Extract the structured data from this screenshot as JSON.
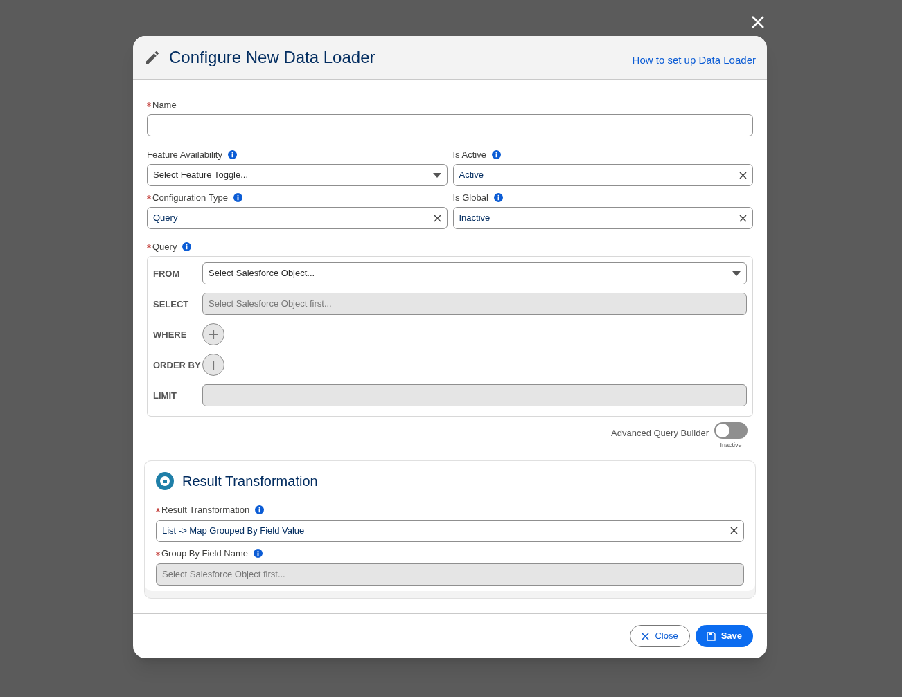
{
  "modal": {
    "title": "Configure New Data Loader",
    "help_link": "How to set up Data Loader"
  },
  "fields": [
    {
      "label": "Name",
      "required": true,
      "info": false,
      "kind": "text"
    },
    {
      "label": "Feature Availability",
      "required": false,
      "info": true,
      "kind": "select",
      "placeholder": "Select Feature Toggle..."
    },
    {
      "label": "Is Active",
      "required": false,
      "info": true,
      "kind": "clearable",
      "value": "Active"
    },
    {
      "label": "Configuration Type",
      "required": true,
      "info": true,
      "kind": "clearable",
      "value": "Query"
    },
    {
      "label": "Is Global",
      "required": false,
      "info": true,
      "kind": "clearable",
      "value": "Inactive"
    }
  ],
  "query": {
    "label": "Query",
    "required": true,
    "info": true,
    "rows": [
      {
        "label": "FROM",
        "kind": "select",
        "placeholder": "Select Salesforce Object..."
      },
      {
        "label": "SELECT",
        "kind": "disabled",
        "placeholder": "Select Salesforce Object first..."
      },
      {
        "label": "WHERE",
        "kind": "add"
      },
      {
        "label": "ORDER BY",
        "kind": "add"
      },
      {
        "label": "LIMIT",
        "kind": "disabled"
      }
    ],
    "advanced": {
      "label": "Advanced Query Builder",
      "on": false,
      "status": "Inactive"
    }
  },
  "result": {
    "title": "Result Transformation",
    "fields": [
      {
        "label": "Result Transformation",
        "required": true,
        "info": true,
        "kind": "clearable",
        "value": "List -> Map Grouped By Field Value"
      },
      {
        "label": "Group By Field Name",
        "required": true,
        "info": true,
        "kind": "disabled",
        "placeholder": "Select Salesforce Object first..."
      }
    ]
  },
  "buttons": [
    {
      "label": "Close",
      "kind": "outline"
    },
    {
      "label": "Save",
      "kind": "primary"
    }
  ]
}
